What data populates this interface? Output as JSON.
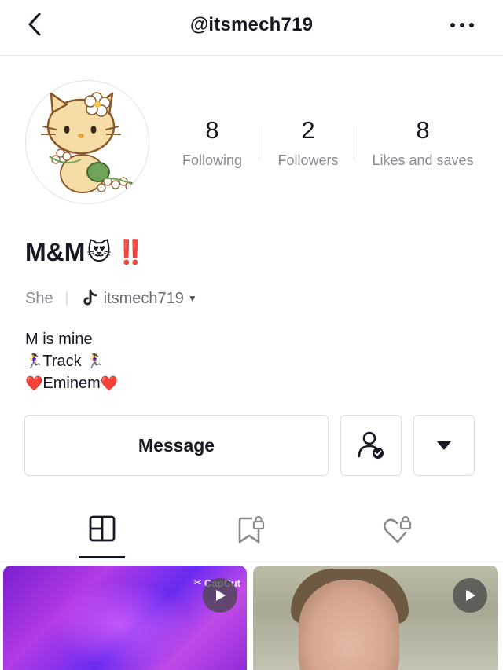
{
  "header": {
    "username_title": "@itsmech719",
    "back_icon": "chevron-left-icon",
    "more_icon": "more-horizontal-icon"
  },
  "profile": {
    "avatar_description_icon": "hello-kitty-avatar",
    "stats": [
      {
        "number": "8",
        "label": "Following"
      },
      {
        "number": "2",
        "label": "Followers"
      },
      {
        "number": "8",
        "label": "Likes and saves"
      }
    ],
    "display_name": "M&M",
    "name_emojis": [
      "😻",
      "‼️"
    ],
    "pronoun": "She",
    "tiktok_handle": "itsmech719",
    "bio_lines": [
      {
        "prefix": "",
        "text": "M is mine",
        "suffix": ""
      },
      {
        "prefix": "🏃‍♀️",
        "text": "Track ",
        "suffix": "🏃‍♀️"
      },
      {
        "prefix": "❤️",
        "text": "Eminem",
        "suffix": "❤️"
      }
    ]
  },
  "actions": {
    "message_label": "Message",
    "follow_status_icon": "user-check-icon",
    "dropdown_icon": "caret-down-icon"
  },
  "tabs": [
    {
      "name": "videos",
      "icon": "grid-icon",
      "active": true
    },
    {
      "name": "favorites",
      "icon": "bookmark-lock-icon",
      "active": false
    },
    {
      "name": "liked",
      "icon": "heart-lock-icon",
      "active": false
    }
  ],
  "videos": [
    {
      "watermark": "CapCut",
      "icon": "play-icon"
    },
    {
      "watermark": "",
      "icon": "play-icon"
    }
  ],
  "colors": {
    "text_primary": "#161823",
    "text_secondary": "#8a8b91",
    "border": "#dcdcdc",
    "emoji_red": "#e2263b"
  }
}
